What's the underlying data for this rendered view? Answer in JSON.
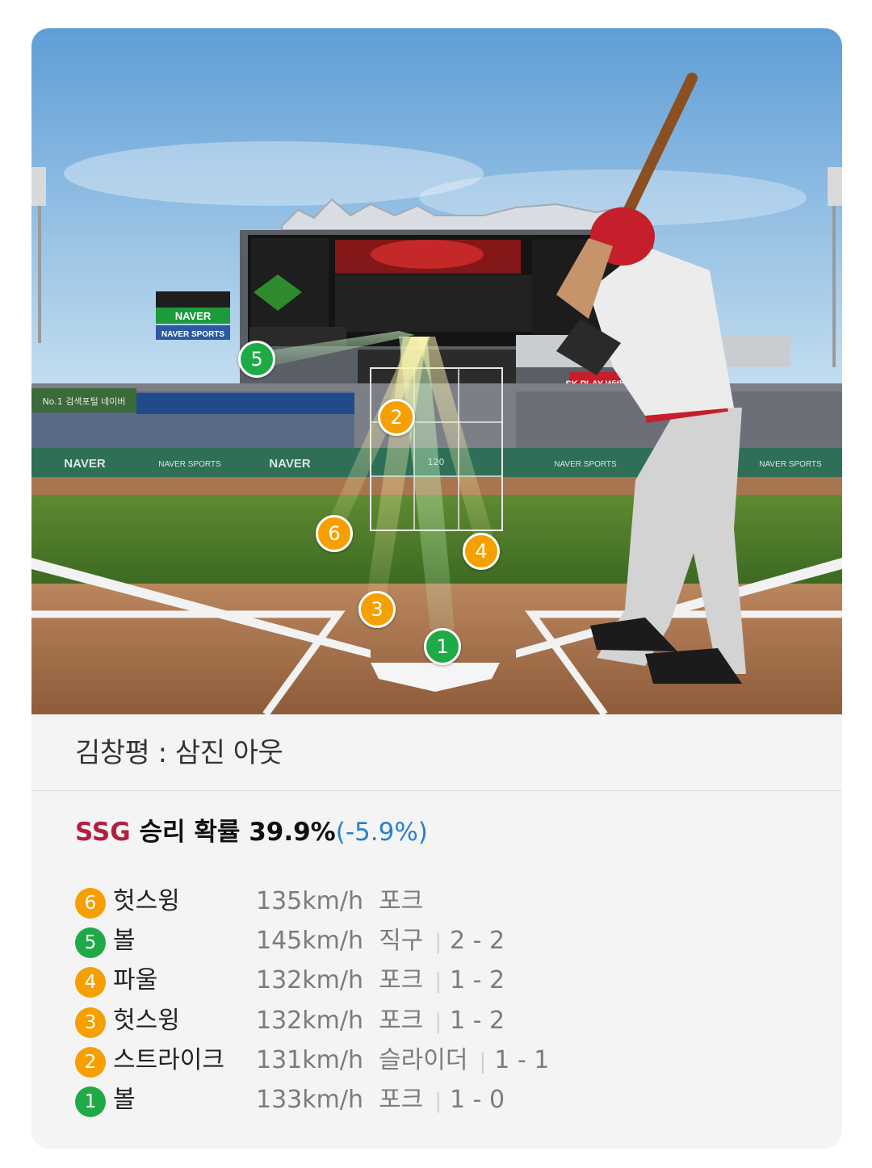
{
  "scene": {
    "signs": {
      "naver_sign": "NAVER",
      "naver_sports_sign": "NAVER SPORTS",
      "wall_logo_1": "NAVER",
      "wall_logo_2": "NAVER SPORTS",
      "wall_logo_3": "NAVER",
      "wall_logo_4": "NAVER SPORTS",
      "wall_logo_5": "NAVER SPORTS",
      "sk_sign": "SK PLAY With",
      "stand_banner": "No.1 검색포털 네이버",
      "zone_speed": "120"
    },
    "markers": [
      {
        "number": "1",
        "color": "green"
      },
      {
        "number": "2",
        "color": "yellow"
      },
      {
        "number": "3",
        "color": "yellow"
      },
      {
        "number": "4",
        "color": "yellow"
      },
      {
        "number": "5",
        "color": "green"
      },
      {
        "number": "6",
        "color": "yellow"
      }
    ]
  },
  "result_line": "김창평 : 삼진 아웃",
  "win_probability": {
    "team": "SSG",
    "label": "승리 확률",
    "value": "39.9%",
    "change": "(-5.9%)"
  },
  "pitches": [
    {
      "number": "6",
      "color": "yellow",
      "result": "헛스윙",
      "speed": "135km/h",
      "type": "포크",
      "count": ""
    },
    {
      "number": "5",
      "color": "green",
      "result": "볼",
      "speed": "145km/h",
      "type": "직구",
      "count": "2 - 2"
    },
    {
      "number": "4",
      "color": "yellow",
      "result": "파울",
      "speed": "132km/h",
      "type": "포크",
      "count": "1 - 2"
    },
    {
      "number": "3",
      "color": "yellow",
      "result": "헛스윙",
      "speed": "132km/h",
      "type": "포크",
      "count": "1 - 2"
    },
    {
      "number": "2",
      "color": "yellow",
      "result": "스트라이크",
      "speed": "131km/h",
      "type": "슬라이더",
      "count": "1 - 1"
    },
    {
      "number": "1",
      "color": "green",
      "result": "볼",
      "speed": "133km/h",
      "type": "포크",
      "count": "1 - 0"
    }
  ],
  "colors": {
    "yellow_badge": "#f5a000",
    "green_badge": "#1faa48",
    "team": "#b2203f",
    "change": "#2a7fd1"
  }
}
